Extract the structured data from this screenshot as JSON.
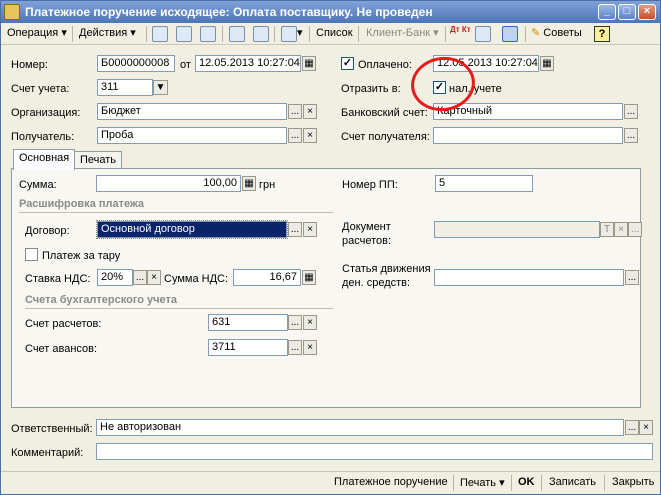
{
  "window": {
    "title": "Платежное поручение исходящее: Оплата поставщику. Не проведен",
    "min": "_",
    "max": "□",
    "close": "×"
  },
  "toolbar": {
    "operation": "Операция",
    "actions": "Действия",
    "list": "Список",
    "client_bank": "Клиент-Банк",
    "advice": "Советы",
    "help": "?",
    "dt_kt": "Дт Кт"
  },
  "header": {
    "number_label": "Номер:",
    "number": "Б0000000008",
    "from_label": "от",
    "date": "12.05.2013 10:27:04",
    "paid_label": "Оплачено:",
    "paid_checked": true,
    "paid_date": "12.05.2013 10:27:04",
    "account_label": "Счет учета:",
    "account": "311",
    "reflect_label": "Отразить в:",
    "reflect_checked": true,
    "reflect_text": "нал. учете",
    "org_label": "Организация:",
    "org": "Бюджет",
    "bank_account_label": "Банковский счет:",
    "bank_account": "Карточный",
    "recipient_label": "Получатель:",
    "recipient": "Проба",
    "recipient_account_label": "Счет получателя:",
    "recipient_account": ""
  },
  "tabs": [
    "Основная",
    "Печать"
  ],
  "main": {
    "sum_label": "Сумма:",
    "sum": "100,00",
    "currency": "грн",
    "pp_number_label": "Номер ПП:",
    "pp_number": "5",
    "breakdown_title": "Расшифровка платежа",
    "contract_label": "Договор:",
    "contract": "Основной договор",
    "settle_doc_label1": "Документ",
    "settle_doc_label2": "расчетов:",
    "settle_doc": "",
    "tare_label": "Платеж за тару",
    "tare_checked": false,
    "vat_rate_label": "Ставка НДС:",
    "vat_rate": "20%",
    "vat_sum_label": "Сумма НДС:",
    "vat_sum": "16,67",
    "cash_flow_label1": "Статья движения",
    "cash_flow_label2": "ден. средств:",
    "cash_flow": "",
    "accounts_title": "Счета бухгалтерского учета",
    "settle_account_label": "Счет расчетов:",
    "settle_account": "631",
    "advance_account_label": "Счет авансов:",
    "advance_account": "3711"
  },
  "footer_fields": {
    "responsible_label": "Ответственный:",
    "responsible": "Не авторизован",
    "comment_label": "Комментарий:",
    "comment": ""
  },
  "bottom": {
    "payment_order": "Платежное поручение",
    "print": "Печать",
    "ok": "OK",
    "save": "Записать",
    "close": "Закрыть"
  },
  "glyphs": {
    "dots": "...",
    "clear": "×",
    "check": "✓",
    "calendar": "▦",
    "down": "▼",
    "dropdown": "▾",
    "t": "T"
  }
}
